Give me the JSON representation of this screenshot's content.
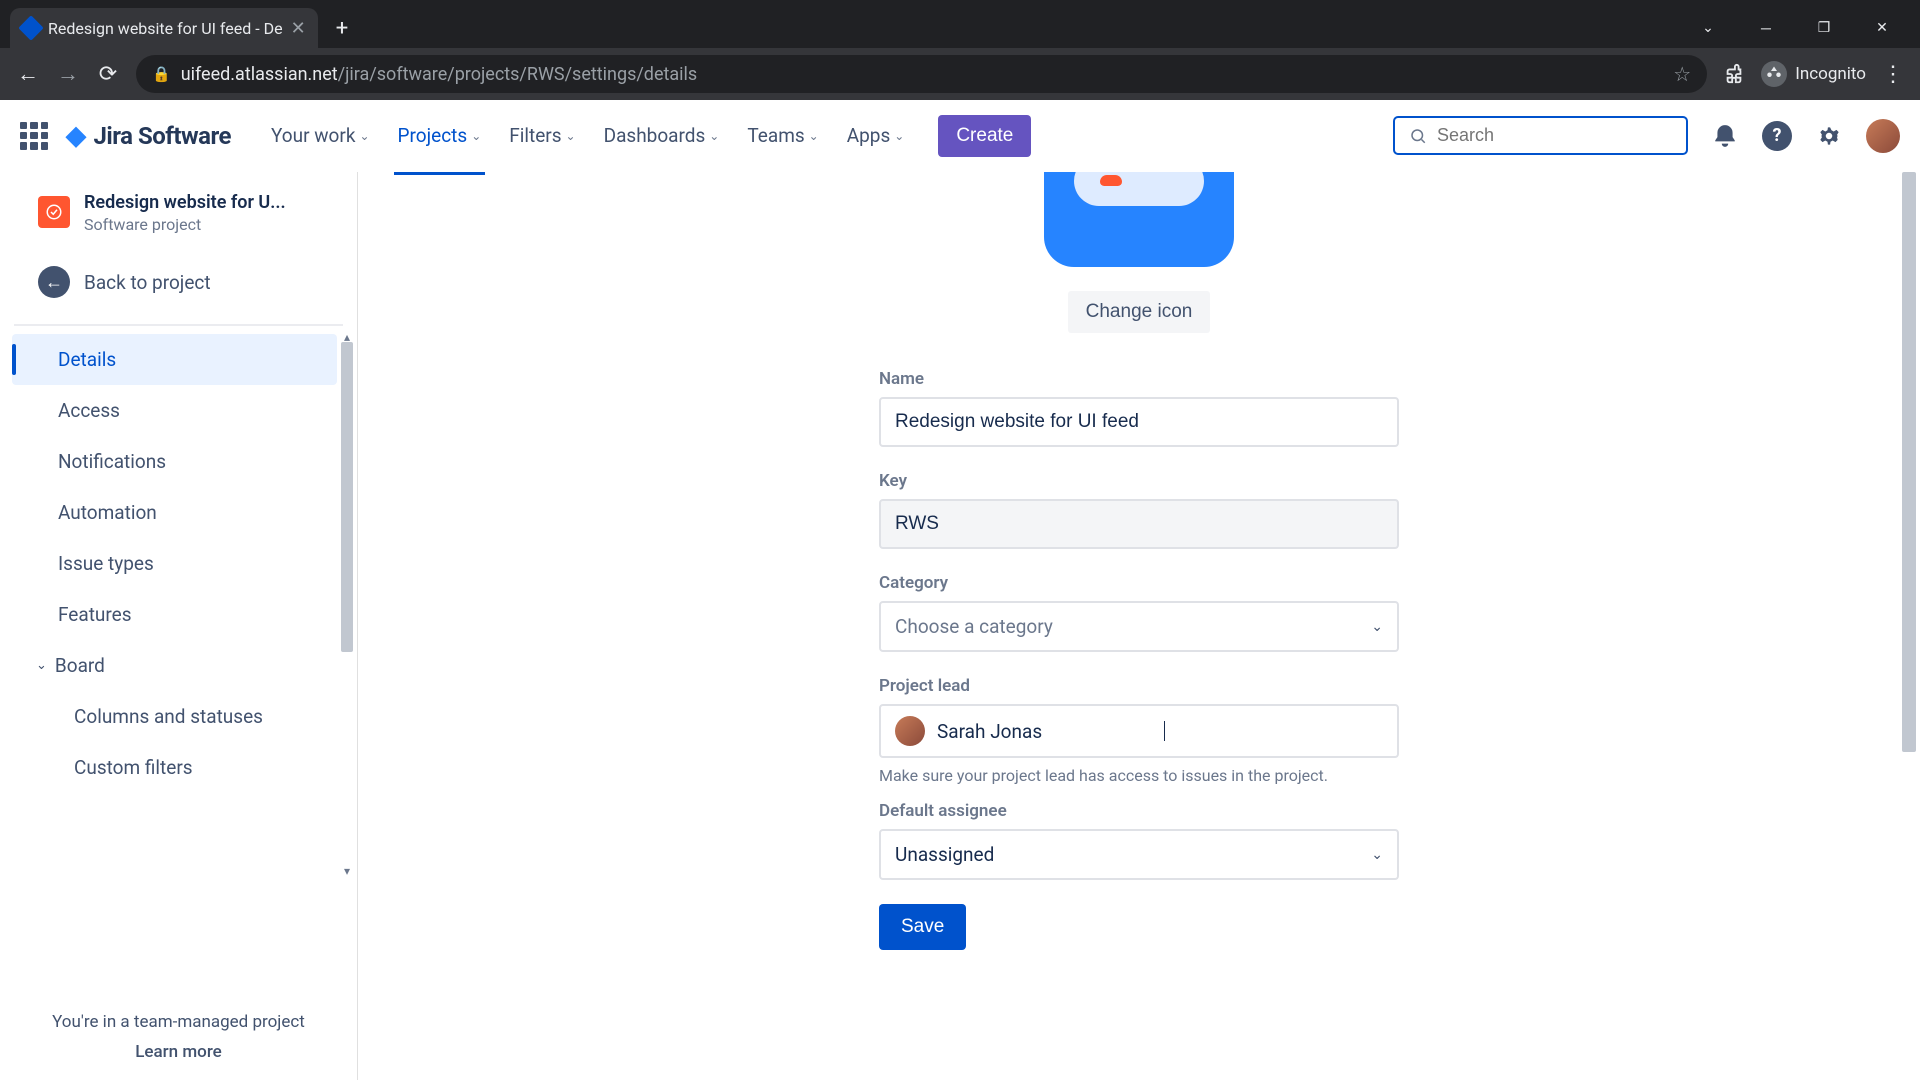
{
  "browser": {
    "tab_title": "Redesign website for UI feed - De",
    "url_host": "uifeed.atlassian.net",
    "url_path": "/jira/software/projects/RWS/settings/details",
    "incognito_label": "Incognito"
  },
  "topbar": {
    "logo_text": "Jira Software",
    "nav": {
      "your_work": "Your work",
      "projects": "Projects",
      "filters": "Filters",
      "dashboards": "Dashboards",
      "teams": "Teams",
      "apps": "Apps"
    },
    "create_label": "Create",
    "search_placeholder": "Search"
  },
  "sidebar": {
    "project_title": "Redesign website for U...",
    "project_subtitle": "Software project",
    "back_label": "Back to project",
    "items": {
      "details": "Details",
      "access": "Access",
      "notifications": "Notifications",
      "automation": "Automation",
      "issue_types": "Issue types",
      "features": "Features",
      "board": "Board",
      "columns": "Columns and statuses",
      "custom_filters": "Custom filters"
    },
    "footer_text": "You're in a team-managed project",
    "learn_more": "Learn more"
  },
  "form": {
    "change_icon_label": "Change icon",
    "name_label": "Name",
    "name_value": "Redesign website for UI feed",
    "key_label": "Key",
    "key_value": "RWS",
    "category_label": "Category",
    "category_placeholder": "Choose a category",
    "lead_label": "Project lead",
    "lead_value": "Sarah Jonas",
    "lead_helper": "Make sure your project lead has access to issues in the project.",
    "assignee_label": "Default assignee",
    "assignee_value": "Unassigned",
    "save_label": "Save"
  }
}
